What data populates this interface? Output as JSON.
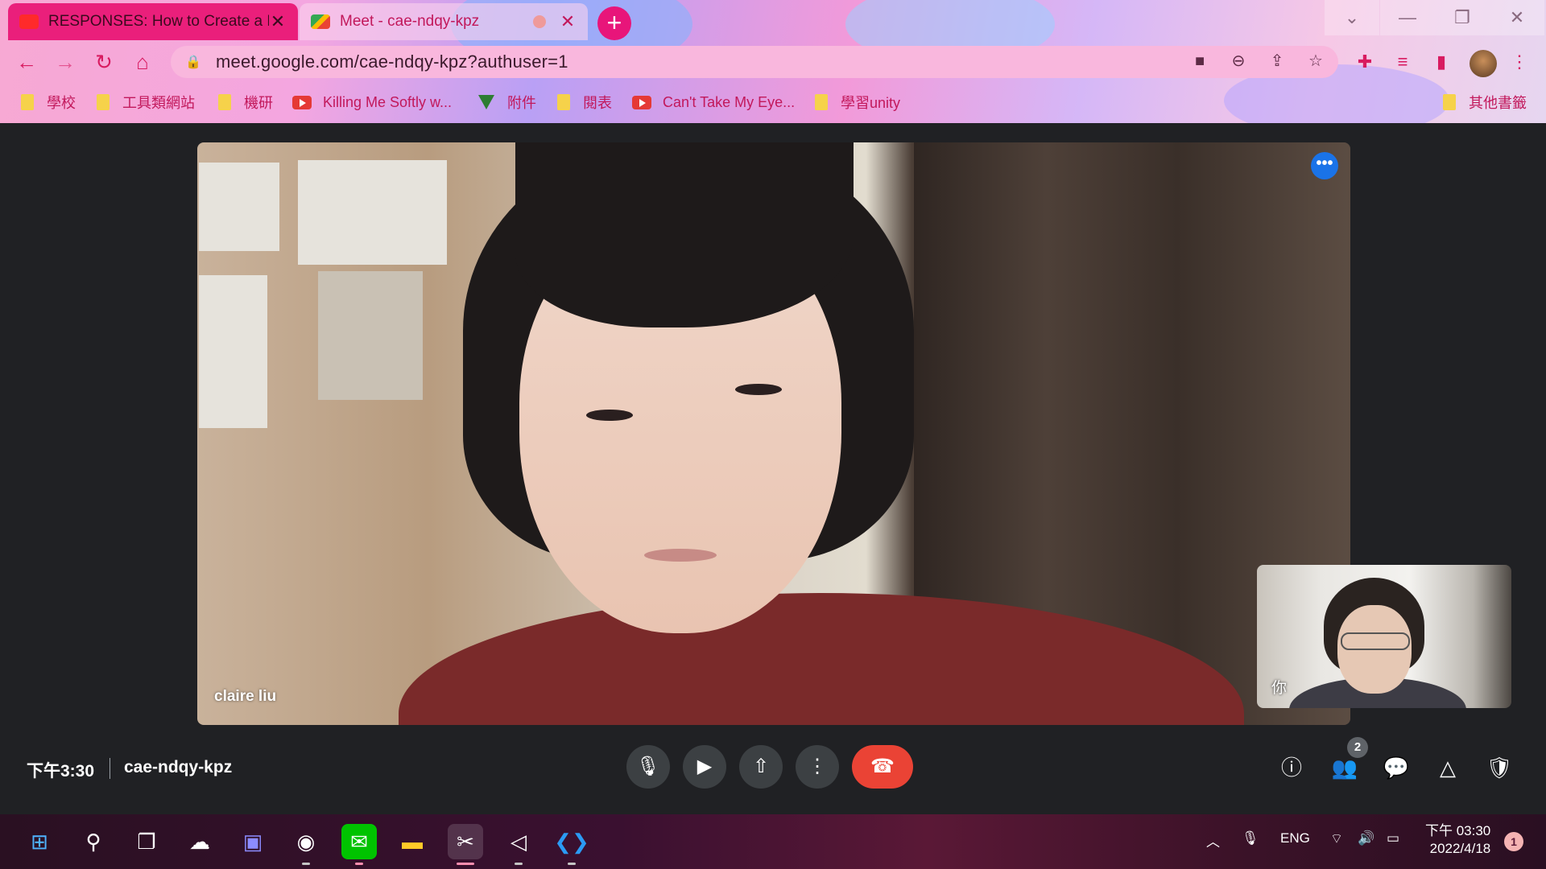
{
  "browser": {
    "tabs": [
      {
        "title": "RESPONSES: How to Create a F",
        "favicon": "youtube-icon"
      },
      {
        "title": "Meet - cae-ndqy-kpz",
        "favicon": "google-meet-icon"
      }
    ],
    "url": "meet.google.com/cae-ndqy-kpz?authuser=1",
    "bookmarks": [
      {
        "label": "學校",
        "icon": "folder-icon"
      },
      {
        "label": "工具類網站",
        "icon": "folder-icon"
      },
      {
        "label": "機研",
        "icon": "folder-icon"
      },
      {
        "label": "Killing Me Softly w...",
        "icon": "youtube-icon"
      },
      {
        "label": "附件",
        "icon": "vue-icon"
      },
      {
        "label": "閱表",
        "icon": "folder-icon"
      },
      {
        "label": "Can't Take My Eye...",
        "icon": "youtube-icon"
      },
      {
        "label": "學習unity",
        "icon": "folder-icon"
      }
    ],
    "other_bookmarks": "其他書籤",
    "accent": "#e8157a"
  },
  "meet": {
    "participant_name": "claire liu",
    "self_label": "你",
    "time": "下午3:30",
    "meeting_code": "cae-ndqy-kpz",
    "participant_count": "2",
    "leave_color": "#ea4335"
  },
  "taskbar": {
    "language": "ENG",
    "clock_time": "下午 03:30",
    "clock_date": "2022/4/18",
    "notification_count": "1"
  }
}
